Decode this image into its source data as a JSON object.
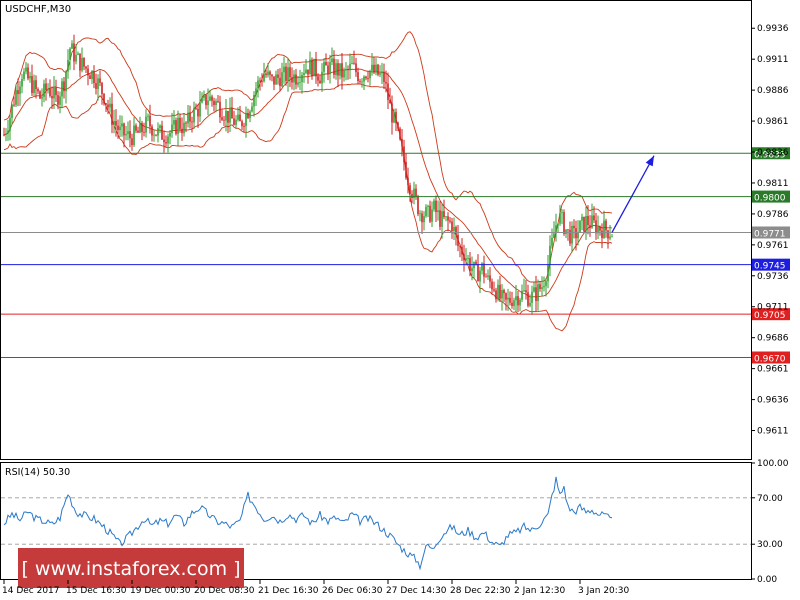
{
  "chart_data": [
    {
      "type": "candlestick",
      "title": "USDCHF,M30",
      "symbol": "USDCHF",
      "timeframe": "M30",
      "ylim": [
        0.9588,
        0.9958
      ],
      "y_ticks": [
        "0.9936",
        "0.9911",
        "0.9886",
        "0.9861",
        "0.9836",
        "0.9811",
        "0.9786",
        "0.9761",
        "0.9736",
        "0.9711",
        "0.9686",
        "0.9661",
        "0.9636",
        "0.9611"
      ],
      "x_ticks": [
        "14 Dec 2017",
        "15 Dec 16:30",
        "19 Dec 00:30",
        "20 Dec 08:30",
        "21 Dec 16:30",
        "26 Dec 06:30",
        "27 Dec 14:30",
        "28 Dec 22:30",
        "2 Jan 12:30",
        "3 Jan 20:30"
      ],
      "x_tick_index": [
        0,
        32,
        64,
        96,
        128,
        160,
        192,
        224,
        256,
        288
      ],
      "candle_count": 305,
      "grid": false,
      "price_path": [
        {
          "i": 0,
          "p": 0.985
        },
        {
          "i": 3,
          "p": 0.9865
        },
        {
          "i": 6,
          "p": 0.9885
        },
        {
          "i": 9,
          "p": 0.99
        },
        {
          "i": 13,
          "p": 0.9893
        },
        {
          "i": 18,
          "p": 0.988
        },
        {
          "i": 22,
          "p": 0.9888
        },
        {
          "i": 26,
          "p": 0.9878
        },
        {
          "i": 30,
          "p": 0.9893
        },
        {
          "i": 33,
          "p": 0.992
        },
        {
          "i": 36,
          "p": 0.9912
        },
        {
          "i": 40,
          "p": 0.9905
        },
        {
          "i": 45,
          "p": 0.9898
        },
        {
          "i": 50,
          "p": 0.9882
        },
        {
          "i": 54,
          "p": 0.9864
        },
        {
          "i": 58,
          "p": 0.9852
        },
        {
          "i": 63,
          "p": 0.9848
        },
        {
          "i": 68,
          "p": 0.9852
        },
        {
          "i": 72,
          "p": 0.986
        },
        {
          "i": 76,
          "p": 0.9852
        },
        {
          "i": 80,
          "p": 0.985
        },
        {
          "i": 84,
          "p": 0.9852
        },
        {
          "i": 87,
          "p": 0.986
        },
        {
          "i": 90,
          "p": 0.9855
        },
        {
          "i": 94,
          "p": 0.9866
        },
        {
          "i": 98,
          "p": 0.9872
        },
        {
          "i": 102,
          "p": 0.988
        },
        {
          "i": 106,
          "p": 0.9876
        },
        {
          "i": 110,
          "p": 0.9868
        },
        {
          "i": 114,
          "p": 0.9862
        },
        {
          "i": 118,
          "p": 0.9858
        },
        {
          "i": 122,
          "p": 0.987
        },
        {
          "i": 126,
          "p": 0.9888
        },
        {
          "i": 130,
          "p": 0.99
        },
        {
          "i": 134,
          "p": 0.9893
        },
        {
          "i": 138,
          "p": 0.9897
        },
        {
          "i": 142,
          "p": 0.9898
        },
        {
          "i": 146,
          "p": 0.9897
        },
        {
          "i": 150,
          "p": 0.9904
        },
        {
          "i": 154,
          "p": 0.9905
        },
        {
          "i": 158,
          "p": 0.9898
        },
        {
          "i": 162,
          "p": 0.9905
        },
        {
          "i": 166,
          "p": 0.9903
        },
        {
          "i": 170,
          "p": 0.9898
        },
        {
          "i": 174,
          "p": 0.9905
        },
        {
          "i": 178,
          "p": 0.9897
        },
        {
          "i": 182,
          "p": 0.9902
        },
        {
          "i": 186,
          "p": 0.99
        },
        {
          "i": 190,
          "p": 0.9895
        },
        {
          "i": 193,
          "p": 0.9872
        },
        {
          "i": 196,
          "p": 0.9855
        },
        {
          "i": 199,
          "p": 0.9835
        },
        {
          "i": 202,
          "p": 0.9815
        },
        {
          "i": 205,
          "p": 0.98
        },
        {
          "i": 208,
          "p": 0.9788
        },
        {
          "i": 212,
          "p": 0.9785
        },
        {
          "i": 215,
          "p": 0.979
        },
        {
          "i": 218,
          "p": 0.9782
        },
        {
          "i": 221,
          "p": 0.978
        },
        {
          "i": 224,
          "p": 0.9778
        },
        {
          "i": 227,
          "p": 0.976
        },
        {
          "i": 230,
          "p": 0.9755
        },
        {
          "i": 233,
          "p": 0.9745
        },
        {
          "i": 236,
          "p": 0.9738
        },
        {
          "i": 239,
          "p": 0.9742
        },
        {
          "i": 242,
          "p": 0.9732
        },
        {
          "i": 245,
          "p": 0.9728
        },
        {
          "i": 248,
          "p": 0.9718
        },
        {
          "i": 251,
          "p": 0.9714
        },
        {
          "i": 254,
          "p": 0.9718
        },
        {
          "i": 257,
          "p": 0.972
        },
        {
          "i": 260,
          "p": 0.9722
        },
        {
          "i": 263,
          "p": 0.9718
        },
        {
          "i": 266,
          "p": 0.9722
        },
        {
          "i": 269,
          "p": 0.9728
        },
        {
          "i": 272,
          "p": 0.9745
        },
        {
          "i": 275,
          "p": 0.977
        },
        {
          "i": 277,
          "p": 0.9785
        },
        {
          "i": 279,
          "p": 0.978
        },
        {
          "i": 282,
          "p": 0.977
        },
        {
          "i": 285,
          "p": 0.9768
        },
        {
          "i": 288,
          "p": 0.9775
        },
        {
          "i": 291,
          "p": 0.978
        },
        {
          "i": 294,
          "p": 0.9778
        },
        {
          "i": 297,
          "p": 0.9775
        },
        {
          "i": 300,
          "p": 0.9774
        },
        {
          "i": 304,
          "p": 0.9771
        }
      ],
      "levels": [
        {
          "price": 0.9835,
          "label": "0.9835",
          "color": "#2a7a2a"
        },
        {
          "price": 0.98,
          "label": "0.9800",
          "color": "#2a7a2a"
        },
        {
          "price": 0.9771,
          "label": "0.9771",
          "color": "#8c8c8c"
        },
        {
          "price": 0.9745,
          "label": "0.9745",
          "color": "#1d1de0"
        },
        {
          "price": 0.9705,
          "label": "0.9705",
          "color": "#e02020"
        },
        {
          "price": 0.967,
          "label": "0.9670",
          "color": "#e02020"
        }
      ],
      "arrow": {
        "from": {
          "i": 304,
          "p": 0.9771
        },
        "to": {
          "i": 325,
          "p": 0.9833
        },
        "color": "#1d1de0"
      },
      "colors": {
        "bull": "#2e9e2e",
        "bear": "#cc1f1f",
        "bands": "#cc3a1a",
        "axis": "#000000"
      }
    },
    {
      "type": "line",
      "title": "RSI(14) 50.30",
      "indicator": "RSI(14)",
      "value": 50.3,
      "ylim": [
        0,
        100
      ],
      "y_ticks": [
        "100.00",
        "70.00",
        "30.00",
        "0.00"
      ],
      "levels": [
        70,
        30
      ],
      "color": "#2a78c8",
      "values_path": [
        {
          "i": 0,
          "v": 48
        },
        {
          "i": 4,
          "v": 56
        },
        {
          "i": 8,
          "v": 51
        },
        {
          "i": 12,
          "v": 58
        },
        {
          "i": 16,
          "v": 52
        },
        {
          "i": 20,
          "v": 50
        },
        {
          "i": 24,
          "v": 47
        },
        {
          "i": 28,
          "v": 53
        },
        {
          "i": 32,
          "v": 74
        },
        {
          "i": 36,
          "v": 58
        },
        {
          "i": 40,
          "v": 55
        },
        {
          "i": 45,
          "v": 52
        },
        {
          "i": 50,
          "v": 45
        },
        {
          "i": 54,
          "v": 38
        },
        {
          "i": 58,
          "v": 30
        },
        {
          "i": 62,
          "v": 36
        },
        {
          "i": 66,
          "v": 44
        },
        {
          "i": 70,
          "v": 52
        },
        {
          "i": 74,
          "v": 46
        },
        {
          "i": 78,
          "v": 50
        },
        {
          "i": 82,
          "v": 48
        },
        {
          "i": 86,
          "v": 55
        },
        {
          "i": 90,
          "v": 48
        },
        {
          "i": 94,
          "v": 57
        },
        {
          "i": 98,
          "v": 62
        },
        {
          "i": 102,
          "v": 56
        },
        {
          "i": 106,
          "v": 50
        },
        {
          "i": 110,
          "v": 48
        },
        {
          "i": 114,
          "v": 45
        },
        {
          "i": 118,
          "v": 50
        },
        {
          "i": 122,
          "v": 72
        },
        {
          "i": 126,
          "v": 62
        },
        {
          "i": 130,
          "v": 52
        },
        {
          "i": 134,
          "v": 55
        },
        {
          "i": 138,
          "v": 50
        },
        {
          "i": 142,
          "v": 56
        },
        {
          "i": 146,
          "v": 52
        },
        {
          "i": 150,
          "v": 55
        },
        {
          "i": 154,
          "v": 48
        },
        {
          "i": 158,
          "v": 55
        },
        {
          "i": 162,
          "v": 50
        },
        {
          "i": 166,
          "v": 53
        },
        {
          "i": 170,
          "v": 48
        },
        {
          "i": 174,
          "v": 56
        },
        {
          "i": 178,
          "v": 50
        },
        {
          "i": 182,
          "v": 52
        },
        {
          "i": 186,
          "v": 48
        },
        {
          "i": 190,
          "v": 42
        },
        {
          "i": 194,
          "v": 36
        },
        {
          "i": 198,
          "v": 28
        },
        {
          "i": 202,
          "v": 22
        },
        {
          "i": 206,
          "v": 17
        },
        {
          "i": 208,
          "v": 12
        },
        {
          "i": 210,
          "v": 23
        },
        {
          "i": 212,
          "v": 30
        },
        {
          "i": 214,
          "v": 25
        },
        {
          "i": 217,
          "v": 34
        },
        {
          "i": 220,
          "v": 40
        },
        {
          "i": 224,
          "v": 45
        },
        {
          "i": 228,
          "v": 38
        },
        {
          "i": 232,
          "v": 42
        },
        {
          "i": 236,
          "v": 36
        },
        {
          "i": 240,
          "v": 40
        },
        {
          "i": 244,
          "v": 32
        },
        {
          "i": 248,
          "v": 28
        },
        {
          "i": 252,
          "v": 38
        },
        {
          "i": 256,
          "v": 40
        },
        {
          "i": 260,
          "v": 45
        },
        {
          "i": 264,
          "v": 42
        },
        {
          "i": 268,
          "v": 48
        },
        {
          "i": 272,
          "v": 55
        },
        {
          "i": 274,
          "v": 72
        },
        {
          "i": 276,
          "v": 86
        },
        {
          "i": 278,
          "v": 72
        },
        {
          "i": 280,
          "v": 80
        },
        {
          "i": 282,
          "v": 62
        },
        {
          "i": 285,
          "v": 58
        },
        {
          "i": 288,
          "v": 62
        },
        {
          "i": 291,
          "v": 58
        },
        {
          "i": 294,
          "v": 60
        },
        {
          "i": 297,
          "v": 56
        },
        {
          "i": 300,
          "v": 55
        },
        {
          "i": 304,
          "v": 50
        }
      ]
    }
  ],
  "watermark": {
    "text": "[ www.instaforex.com ]"
  }
}
